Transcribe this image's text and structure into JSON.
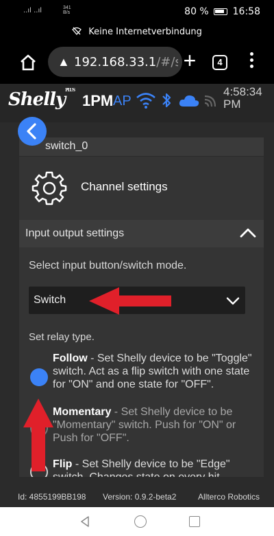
{
  "status_bar": {
    "signal": "..ıl ..ıl",
    "speed_value": "341",
    "speed_unit": "B/s",
    "battery": "80 %",
    "time": "16:58"
  },
  "network_notice": "Keine Internetverbindung",
  "browser": {
    "url_host": "192.168.33.1",
    "url_path": "/#/s",
    "tab_count": "4"
  },
  "app_header": {
    "brand": "Shelly",
    "brand_plus": "PLUS",
    "model": "1PM",
    "ap_label": "AP",
    "time_line1": "4:58:34",
    "time_line2": "PM"
  },
  "card": {
    "switch_name": "switch_0",
    "title": "Channel settings",
    "section_title": "Input output settings",
    "mode_label": "Select input button/switch mode.",
    "mode_value": "Switch",
    "relay_label": "Set relay type.",
    "options": [
      {
        "name": "Follow",
        "desc": " - Set Shelly device to be \"Toggle\" switch. Act as a flip switch with one state for \"ON\" and one state for \"OFF\".",
        "selected": true
      },
      {
        "name": "Momentary",
        "desc": " - Set Shelly device to be \"Momentary\" switch. Push for \"ON\" or Push for \"OFF\".",
        "selected": false
      },
      {
        "name": "Flip",
        "desc": " - Set Shelly device to be \"Edge\" switch. Changes state on every hit.",
        "selected": false
      }
    ]
  },
  "footer": {
    "device_id": "Id: 4855199BB198",
    "version": "Version: 0.9.2-beta2",
    "vendor": "Allterco Robotics"
  },
  "colors": {
    "accent": "#3b82f6",
    "annotation_arrow": "#e0202a"
  }
}
